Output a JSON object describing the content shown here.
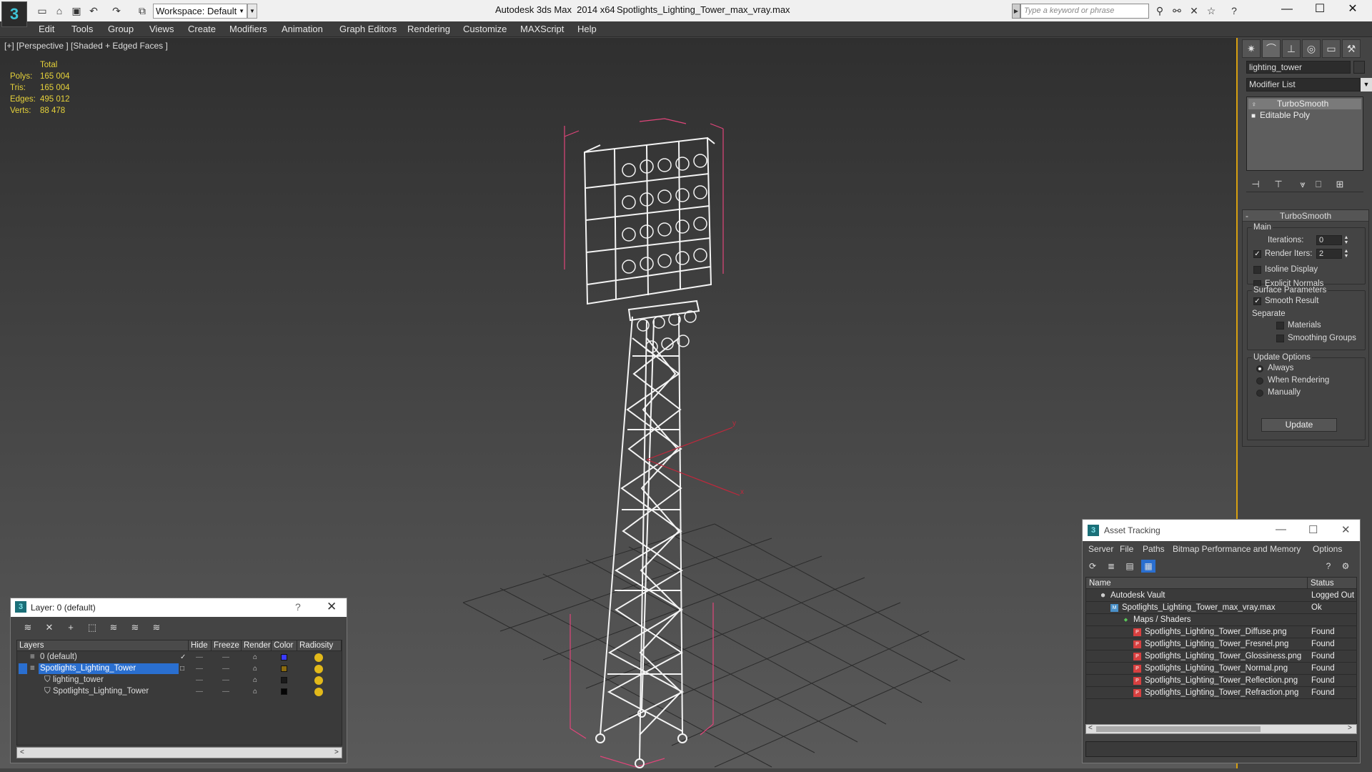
{
  "titlebar": {
    "workspace": "Workspace: Default",
    "app_title": "Autodesk 3ds Max  2014 x64",
    "file_title": "Spotlights_Lighting_Tower_max_vray.max",
    "search_placeholder": "Type a keyword or phrase"
  },
  "menu": [
    "Edit",
    "Tools",
    "Group",
    "Views",
    "Create",
    "Modifiers",
    "Animation",
    "Graph Editors",
    "Rendering",
    "Customize",
    "MAXScript",
    "Help"
  ],
  "viewport": {
    "label": "[+] [Perspective ] [Shaded + Edged Faces ]",
    "stats": {
      "header": "Total",
      "rows": [
        {
          "label": "Polys:",
          "value": "165 004"
        },
        {
          "label": "Tris:",
          "value": "165 004"
        },
        {
          "label": "Edges:",
          "value": "495 012"
        },
        {
          "label": "Verts:",
          "value": "88 478"
        }
      ]
    },
    "axis_labels": {
      "x": "x",
      "y": "y"
    }
  },
  "command_panel": {
    "object_name": "lighting_tower",
    "modifier_list": "Modifier List",
    "stack": [
      "TurboSmooth",
      "Editable Poly"
    ],
    "rollout_title": "TurboSmooth",
    "main_group": "Main",
    "iterations_label": "Iterations:",
    "iterations_value": "0",
    "render_iters_label": "Render Iters:",
    "render_iters_value": "2",
    "isoline_label": "Isoline Display",
    "explicit_normals_label": "Explicit Normals",
    "surface_group": "Surface Parameters",
    "smooth_result_label": "Smooth Result",
    "separate_label": "Separate",
    "materials_label": "Materials",
    "smoothing_groups_label": "Smoothing Groups",
    "update_group": "Update Options",
    "update_always": "Always",
    "update_when_rendering": "When Rendering",
    "update_manually": "Manually",
    "update_button": "Update"
  },
  "layer_dialog": {
    "title": "Layer: 0 (default)",
    "columns": [
      "Layers",
      "Hide",
      "Freeze",
      "Render",
      "Color",
      "Radiosity"
    ],
    "rows": [
      {
        "name": "0 (default)",
        "color": "#3a3aff",
        "selected": false
      },
      {
        "name": "Spotlights_Lighting_Tower",
        "color": "#8a6a10",
        "selected": true
      },
      {
        "name": "lighting_tower",
        "color": "#1a1a1a",
        "selected": false
      },
      {
        "name": "Spotlights_Lighting_Tower",
        "color": "#050505",
        "selected": false
      }
    ]
  },
  "asset_dialog": {
    "title": "Asset Tracking",
    "menu": [
      "Server",
      "File",
      "Paths",
      "Bitmap Performance and Memory",
      "Options"
    ],
    "columns": [
      "Name",
      "Status"
    ],
    "rows": [
      {
        "name": "Autodesk Vault",
        "status": "Logged Out"
      },
      {
        "name": "Spotlights_Lighting_Tower_max_vray.max",
        "status": "Ok"
      },
      {
        "name": "Maps / Shaders",
        "status": ""
      },
      {
        "name": "Spotlights_Lighting_Tower_Diffuse.png",
        "status": "Found"
      },
      {
        "name": "Spotlights_Lighting_Tower_Fresnel.png",
        "status": "Found"
      },
      {
        "name": "Spotlights_Lighting_Tower_Glossiness.png",
        "status": "Found"
      },
      {
        "name": "Spotlights_Lighting_Tower_Normal.png",
        "status": "Found"
      },
      {
        "name": "Spotlights_Lighting_Tower_Reflection.png",
        "status": "Found"
      },
      {
        "name": "Spotlights_Lighting_Tower_Refraction.png",
        "status": "Found"
      }
    ]
  },
  "colors": {
    "stats_text": "#e6d23a",
    "selection": "#2a6fd0",
    "viewport_border": "#d8a010",
    "bbox": "#e0457a"
  }
}
